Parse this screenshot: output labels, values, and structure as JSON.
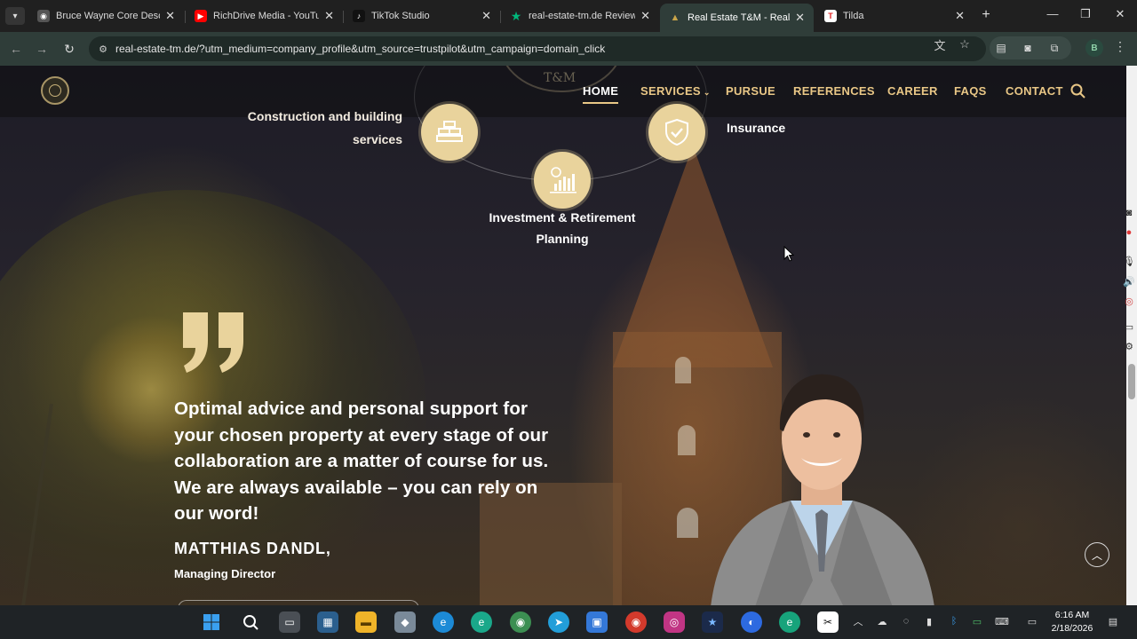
{
  "browser": {
    "tabs": [
      {
        "title": "Bruce Wayne Core Descrip",
        "favicon": "generic-site-icon",
        "color": "#cfcfcf"
      },
      {
        "title": "RichDrive Media - YouTube",
        "favicon": "youtube-icon",
        "color": "#ff0000"
      },
      {
        "title": "TikTok Studio",
        "favicon": "tiktok-icon",
        "color": "#111111"
      },
      {
        "title": "real-estate-tm.de Reviews",
        "favicon": "trustpilot-star-icon",
        "color": "#00b67a"
      },
      {
        "title": "Real Estate T&M - Real Est",
        "favicon": "real-estate-tm-icon",
        "color": "#c9a54a"
      },
      {
        "title": "Tilda",
        "favicon": "tilda-icon",
        "color": "#e02020"
      }
    ],
    "active_tab": 4,
    "url": "real-estate-tm.de/?utm_medium=company_profile&utm_source=trustpilot&utm_campaign=domain_click",
    "profile_initial": "B"
  },
  "site": {
    "seal_text": "T&M",
    "nav": [
      {
        "label": "HOME",
        "active": true
      },
      {
        "label": "SERVICES",
        "has_dropdown": true
      },
      {
        "label": "PURSUE"
      },
      {
        "label": "REFERENCES"
      },
      {
        "label": "CAREER"
      },
      {
        "label": "FAQS"
      },
      {
        "label": "CONTACT"
      }
    ],
    "services": {
      "construction_line1": "Construction and building",
      "construction_line2": "services",
      "investment_line1": "Investment & Retirement",
      "investment_line2": "Planning",
      "insurance": "Insurance"
    },
    "testimonial": {
      "lines": [
        "Optimal advice and personal support for",
        "your chosen property at every stage of our",
        "collaboration are a matter of course for us.",
        "We are always available – you can rely on",
        "our word!"
      ],
      "author": "MATTHIAS DANDL,",
      "role": "Managing Director"
    },
    "accent_color": "#e9c786",
    "circle_color": "#e9d39c"
  },
  "taskbar": {
    "time": "6:16 AM",
    "date": "2/18/2026"
  }
}
